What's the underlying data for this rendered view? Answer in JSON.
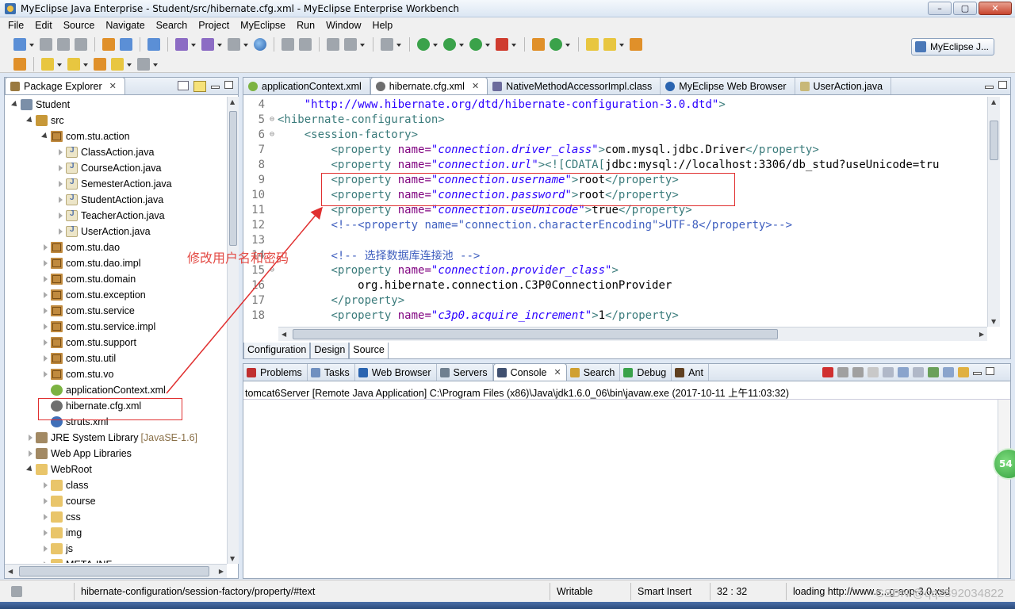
{
  "window": {
    "title": "MyEclipse Java Enterprise - Student/src/hibernate.cfg.xml - MyEclipse Enterprise Workbench",
    "buttons": [
      "–",
      "▢",
      "✕"
    ]
  },
  "menu": [
    "File",
    "Edit",
    "Source",
    "Navigate",
    "Search",
    "Project",
    "MyEclipse",
    "Run",
    "Window",
    "Help"
  ],
  "perspective": {
    "label": "MyEclipse J..."
  },
  "package_explorer": {
    "title": "Package Explorer",
    "tree": [
      {
        "label": "Student",
        "depth": 0,
        "icon": "project",
        "twisty": "open"
      },
      {
        "label": "src",
        "depth": 1,
        "icon": "srcfolder",
        "twisty": "open"
      },
      {
        "label": "com.stu.action",
        "depth": 2,
        "icon": "package",
        "twisty": "open"
      },
      {
        "label": "ClassAction.java",
        "depth": 3,
        "icon": "java",
        "twisty": "closed"
      },
      {
        "label": "CourseAction.java",
        "depth": 3,
        "icon": "java",
        "twisty": "closed"
      },
      {
        "label": "SemesterAction.java",
        "depth": 3,
        "icon": "java",
        "twisty": "closed"
      },
      {
        "label": "StudentAction.java",
        "depth": 3,
        "icon": "java",
        "twisty": "closed"
      },
      {
        "label": "TeacherAction.java",
        "depth": 3,
        "icon": "java",
        "twisty": "closed"
      },
      {
        "label": "UserAction.java",
        "depth": 3,
        "icon": "java",
        "twisty": "closed"
      },
      {
        "label": "com.stu.dao",
        "depth": 2,
        "icon": "package",
        "twisty": "closed"
      },
      {
        "label": "com.stu.dao.impl",
        "depth": 2,
        "icon": "package",
        "twisty": "closed"
      },
      {
        "label": "com.stu.domain",
        "depth": 2,
        "icon": "package",
        "twisty": "closed"
      },
      {
        "label": "com.stu.exception",
        "depth": 2,
        "icon": "package",
        "twisty": "closed"
      },
      {
        "label": "com.stu.service",
        "depth": 2,
        "icon": "package",
        "twisty": "closed"
      },
      {
        "label": "com.stu.service.impl",
        "depth": 2,
        "icon": "package",
        "twisty": "closed"
      },
      {
        "label": "com.stu.support",
        "depth": 2,
        "icon": "package",
        "twisty": "closed"
      },
      {
        "label": "com.stu.util",
        "depth": 2,
        "icon": "package",
        "twisty": "closed"
      },
      {
        "label": "com.stu.vo",
        "depth": 2,
        "icon": "package",
        "twisty": "closed"
      },
      {
        "label": "applicationContext.xml",
        "depth": 2,
        "icon": "xml-spring",
        "twisty": "none"
      },
      {
        "label": "hibernate.cfg.xml",
        "depth": 2,
        "icon": "xml-hib",
        "twisty": "none"
      },
      {
        "label": "struts.xml",
        "depth": 2,
        "icon": "xml-gear",
        "twisty": "none"
      },
      {
        "label": "JRE System Library",
        "suffix": "[JavaSE-1.6]",
        "depth": 1,
        "icon": "lib",
        "twisty": "closed"
      },
      {
        "label": "Web App Libraries",
        "depth": 1,
        "icon": "lib",
        "twisty": "closed"
      },
      {
        "label": "WebRoot",
        "depth": 1,
        "icon": "folder",
        "twisty": "open"
      },
      {
        "label": "class",
        "depth": 2,
        "icon": "folder",
        "twisty": "closed"
      },
      {
        "label": "course",
        "depth": 2,
        "icon": "folder",
        "twisty": "closed"
      },
      {
        "label": "css",
        "depth": 2,
        "icon": "folder",
        "twisty": "closed"
      },
      {
        "label": "img",
        "depth": 2,
        "icon": "folder",
        "twisty": "closed"
      },
      {
        "label": "js",
        "depth": 2,
        "icon": "folder",
        "twisty": "closed"
      },
      {
        "label": "META-INF",
        "depth": 2,
        "icon": "folder",
        "twisty": "closed"
      }
    ]
  },
  "editor": {
    "tabs": [
      {
        "label": "applicationContext.xml",
        "icon": "xml-spring",
        "active": false
      },
      {
        "label": "hibernate.cfg.xml",
        "icon": "xml-hib",
        "active": true,
        "close": "✕"
      },
      {
        "label": "NativeMethodAccessorImpl.class",
        "icon": "class",
        "active": false
      },
      {
        "label": "MyEclipse Web Browser",
        "icon": "globe",
        "active": false
      },
      {
        "label": "UserAction.java",
        "icon": "java",
        "active": false
      }
    ],
    "lines": [
      {
        "n": "4",
        "fold": "",
        "segs": [
          {
            "t": "    ",
            "c": "txt"
          },
          {
            "t": "\"http://www.hibernate.org/dtd/hibernate-configuration-3.0.dtd\"",
            "c": "str"
          },
          {
            "t": ">",
            "c": "tag"
          }
        ]
      },
      {
        "n": "5",
        "fold": "⊖",
        "segs": [
          {
            "t": "<hibernate-configuration>",
            "c": "tag"
          }
        ]
      },
      {
        "n": "6",
        "fold": "⊖",
        "segs": [
          {
            "t": "    ",
            "c": "txt"
          },
          {
            "t": "<session-factory>",
            "c": "tag"
          }
        ]
      },
      {
        "n": "7",
        "fold": "",
        "segs": [
          {
            "t": "        ",
            "c": "txt"
          },
          {
            "t": "<property ",
            "c": "tag"
          },
          {
            "t": "name=",
            "c": "attr"
          },
          {
            "t": "\"connection.driver_class\"",
            "c": "val"
          },
          {
            "t": ">",
            "c": "tag"
          },
          {
            "t": "com.mysql.jdbc.Driver",
            "c": "txt"
          },
          {
            "t": "</property>",
            "c": "tag"
          }
        ]
      },
      {
        "n": "8",
        "fold": "",
        "segs": [
          {
            "t": "        ",
            "c": "txt"
          },
          {
            "t": "<property ",
            "c": "tag"
          },
          {
            "t": "name=",
            "c": "attr"
          },
          {
            "t": "\"connection.url\"",
            "c": "val"
          },
          {
            "t": "><![CDATA[",
            "c": "tag"
          },
          {
            "t": "jdbc:mysql://localhost:3306/db_stud?useUnicode=tru",
            "c": "cdata"
          }
        ]
      },
      {
        "n": "9",
        "fold": "",
        "segs": [
          {
            "t": "        ",
            "c": "txt"
          },
          {
            "t": "<property ",
            "c": "tag"
          },
          {
            "t": "name=",
            "c": "attr"
          },
          {
            "t": "\"connection.username\"",
            "c": "val"
          },
          {
            "t": ">",
            "c": "tag"
          },
          {
            "t": "root",
            "c": "txt"
          },
          {
            "t": "</property>",
            "c": "tag"
          }
        ]
      },
      {
        "n": "10",
        "fold": "",
        "segs": [
          {
            "t": "        ",
            "c": "txt"
          },
          {
            "t": "<property ",
            "c": "tag"
          },
          {
            "t": "name=",
            "c": "attr"
          },
          {
            "t": "\"connection.password\"",
            "c": "val"
          },
          {
            "t": ">",
            "c": "tag"
          },
          {
            "t": "root",
            "c": "txt"
          },
          {
            "t": "</property>",
            "c": "tag"
          }
        ]
      },
      {
        "n": "11",
        "fold": "",
        "segs": [
          {
            "t": "        ",
            "c": "txt"
          },
          {
            "t": "<property ",
            "c": "tag"
          },
          {
            "t": "name=",
            "c": "attr"
          },
          {
            "t": "\"connection.useUnicode\"",
            "c": "val"
          },
          {
            "t": ">",
            "c": "tag"
          },
          {
            "t": "true",
            "c": "txt"
          },
          {
            "t": "</property>",
            "c": "tag"
          }
        ]
      },
      {
        "n": "12",
        "fold": "",
        "segs": [
          {
            "t": "        ",
            "c": "txt"
          },
          {
            "t": "<!--<property name=\"connection.characterEncoding\">UTF-8</property>-->",
            "c": "cmt"
          }
        ]
      },
      {
        "n": "13",
        "fold": "",
        "segs": [
          {
            "t": "",
            "c": "txt"
          }
        ]
      },
      {
        "n": "14",
        "fold": "",
        "segs": [
          {
            "t": "        ",
            "c": "txt"
          },
          {
            "t": "<!-- 选择数据库连接池 -->",
            "c": "cmt"
          }
        ]
      },
      {
        "n": "15",
        "fold": "⊖",
        "segs": [
          {
            "t": "        ",
            "c": "txt"
          },
          {
            "t": "<property ",
            "c": "tag"
          },
          {
            "t": "name=",
            "c": "attr"
          },
          {
            "t": "\"connection.provider_class\"",
            "c": "val"
          },
          {
            "t": ">",
            "c": "tag"
          }
        ]
      },
      {
        "n": "16",
        "fold": "",
        "segs": [
          {
            "t": "            ",
            "c": "txt"
          },
          {
            "t": "org.hibernate.connection.C3P0ConnectionProvider",
            "c": "txt"
          }
        ]
      },
      {
        "n": "17",
        "fold": "",
        "segs": [
          {
            "t": "        ",
            "c": "txt"
          },
          {
            "t": "</property>",
            "c": "tag"
          }
        ]
      },
      {
        "n": "18",
        "fold": "",
        "segs": [
          {
            "t": "        ",
            "c": "txt"
          },
          {
            "t": "<property ",
            "c": "tag"
          },
          {
            "t": "name=",
            "c": "attr"
          },
          {
            "t": "\"c3p0.acquire_increment\"",
            "c": "val"
          },
          {
            "t": ">",
            "c": "tag"
          },
          {
            "t": "1",
            "c": "txt"
          },
          {
            "t": "</property>",
            "c": "tag"
          }
        ]
      }
    ],
    "bottom_tabs": [
      {
        "label": "Configuration",
        "active": false
      },
      {
        "label": "Design",
        "active": false
      },
      {
        "label": "Source",
        "active": true
      }
    ]
  },
  "console": {
    "tabs": [
      {
        "label": "Problems",
        "icon": "problems",
        "active": false
      },
      {
        "label": "Tasks",
        "icon": "tasks",
        "active": false
      },
      {
        "label": "Web Browser",
        "icon": "globe",
        "active": false
      },
      {
        "label": "Servers",
        "icon": "servers",
        "active": false
      },
      {
        "label": "Console",
        "icon": "console",
        "active": true,
        "close": "✕"
      },
      {
        "label": "Search",
        "icon": "search",
        "active": false
      },
      {
        "label": "Debug",
        "icon": "debug",
        "active": false
      },
      {
        "label": "Ant",
        "icon": "ant",
        "active": false
      }
    ],
    "launch": "tomcat6Server [Remote Java Application] C:\\Program Files (x86)\\Java\\jdk1.6.0_06\\bin\\javaw.exe (2017-10-11 上午11:03:32)"
  },
  "statusbar": {
    "path": "hibernate-configuration/session-factory/property/#text",
    "writable": "Writable",
    "insert_mode": "Smart Insert",
    "position": "32 : 32",
    "loading": "loading http://www.s...g-aop-3.0.xsd"
  },
  "annotation": {
    "text": "修改用户名和密码",
    "color": "#e03030"
  },
  "watermark": "CSDN @qq2892034822",
  "badge": "54"
}
